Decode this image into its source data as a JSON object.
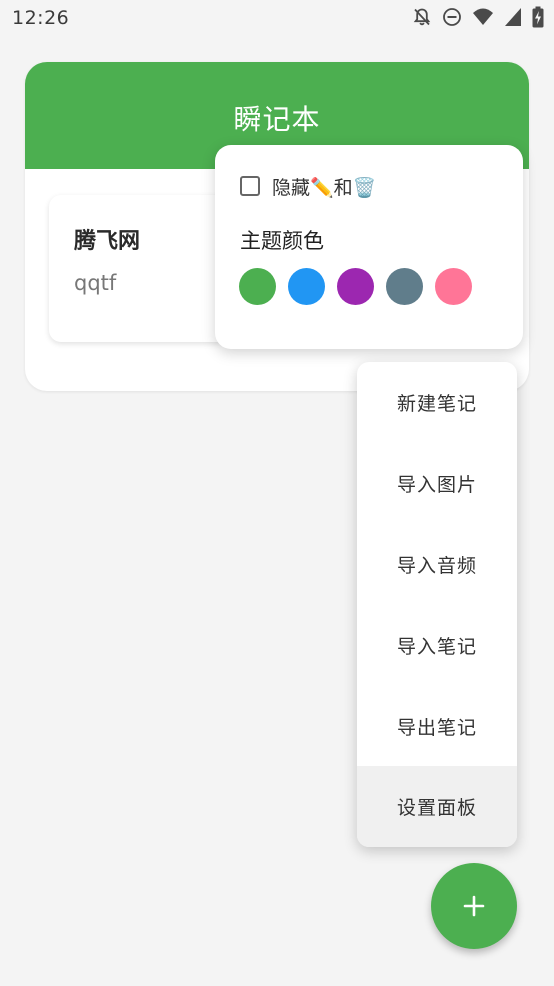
{
  "status_bar": {
    "time": "12:26",
    "icons": [
      "notifications-off-icon",
      "do-not-disturb-icon",
      "wifi-icon",
      "cellular-signal-icon",
      "battery-charging-icon"
    ]
  },
  "app": {
    "title": "瞬记本",
    "theme_color": "#4caf50"
  },
  "notes": [
    {
      "title": "腾飞网",
      "body": "qqtf"
    }
  ],
  "settings_popup": {
    "hide_label": "隐藏✏️和🗑️",
    "hide_checked": false,
    "theme_label": "主题颜色",
    "theme_colors": [
      "#4caf50",
      "#2196f3",
      "#9c27b0",
      "#607d8b",
      "#ff7597"
    ]
  },
  "menu": {
    "items": [
      {
        "label": "新建笔记"
      },
      {
        "label": "导入图片"
      },
      {
        "label": "导入音频"
      },
      {
        "label": "导入笔记"
      },
      {
        "label": "导出笔记"
      },
      {
        "label": "设置面板",
        "active": true
      }
    ]
  },
  "fab": {
    "icon": "plus-icon"
  }
}
